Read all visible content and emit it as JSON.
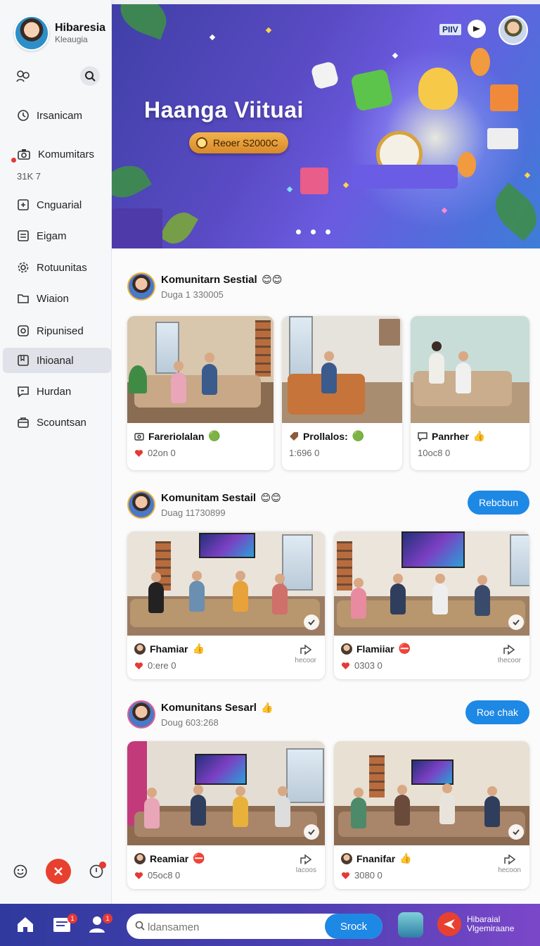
{
  "profile": {
    "name": "Hibaresia",
    "subtitle": "Kleaugia"
  },
  "sidebar": {
    "items": [
      {
        "label": "Irsanicam",
        "icon": "clock-icon"
      },
      {
        "label": "Komumitars",
        "icon": "camera-icon"
      },
      {
        "label": "Cnguarial",
        "icon": "plus-box-icon"
      },
      {
        "label": "Eigam",
        "icon": "document-icon"
      },
      {
        "label": "Rotuunitas",
        "icon": "gear-icon"
      },
      {
        "label": "Wiaion",
        "icon": "folder-icon"
      },
      {
        "label": "Ripunised",
        "icon": "settings-box-icon"
      },
      {
        "label": "Ihioanal",
        "icon": "bookmark-icon"
      },
      {
        "label": "Hurdan",
        "icon": "chat-icon"
      },
      {
        "label": "Scountsan",
        "icon": "bag-icon"
      }
    ],
    "count_label": "31K 7",
    "active_index": 7
  },
  "banner": {
    "title": "Haanga Viituai",
    "cta": "Reoer S2000C",
    "tag": "PIIV",
    "slides": 3
  },
  "posts": [
    {
      "name": "Komunitarn Sestial",
      "emoji": "😊😊",
      "meta": "Duga 1 330005",
      "cards": [
        {
          "title": "Fareriolalan",
          "badge": "🟢",
          "stat": "02on 0"
        },
        {
          "title": "Prollalos:",
          "badge": "🟢",
          "stat": "1:696 0"
        },
        {
          "title": "Panrher",
          "badge": "👍",
          "stat": "10oc8 0"
        }
      ]
    },
    {
      "name": "Komunitam Sestail",
      "emoji": "😊😊",
      "meta": "Duag 11730899",
      "button": "Rebcbun",
      "cards": [
        {
          "title": "Fhamiar",
          "badge": "👍",
          "stat": "0:ere 0",
          "share": "hecoor"
        },
        {
          "title": "Flamiiar",
          "badge": "⛔",
          "stat": "0303 0",
          "share": "Ihecoor"
        }
      ]
    },
    {
      "name": "Komunitans Sesarl",
      "emoji": "👍",
      "meta": "Doug 603:268",
      "button": "Roe chak",
      "cards": [
        {
          "title": "Reamiar",
          "badge": "⛔",
          "stat": "05oc8 0",
          "share": "Iacoos"
        },
        {
          "title": "Fnanifar",
          "badge": "👍",
          "stat": "3080 0",
          "share": "hecoon"
        }
      ]
    }
  ],
  "bottom_bar": {
    "search_placeholder": "ldansamen",
    "search_button": "Srock",
    "badge_messages": "1",
    "badge_friends": "1",
    "app_title": "Hibaraial",
    "app_subtitle": "Vlgemiraane"
  },
  "colors": {
    "accent": "#1e88e5",
    "danger": "#e8402f",
    "banner": "#5a4bc4"
  }
}
